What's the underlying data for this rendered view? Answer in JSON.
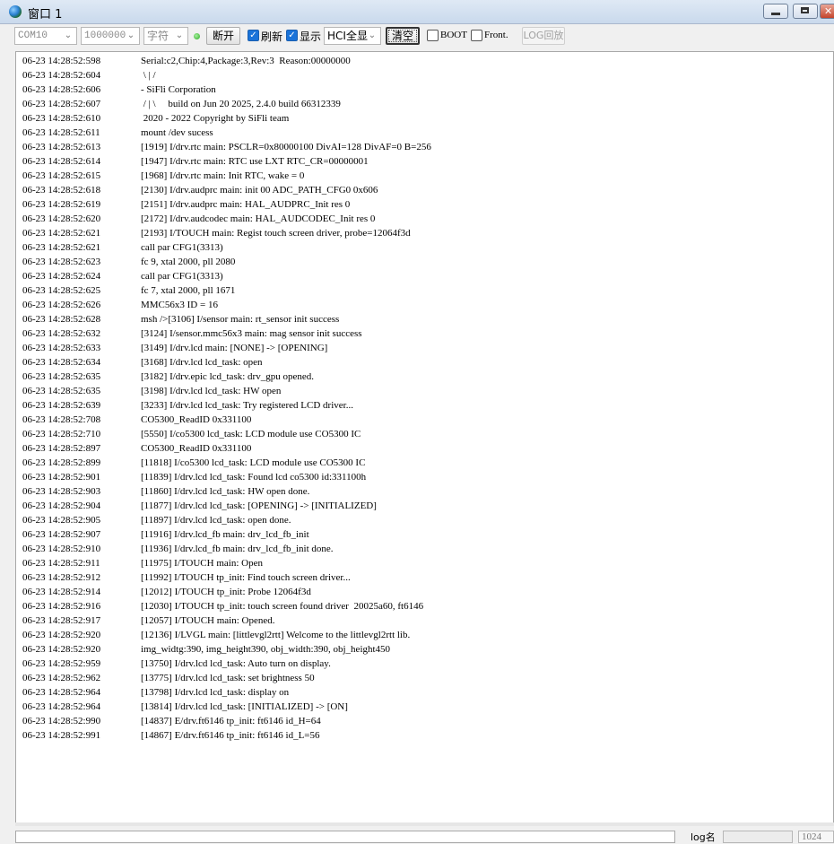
{
  "window": {
    "title": "窗口 1",
    "icon": "globe-icon",
    "minimize_icon": "minimize-icon",
    "maximize_icon": "maximize-icon",
    "close_icon": "close-icon",
    "close_glyph": "✕"
  },
  "toolbar": {
    "port": "COM10",
    "baud": "1000000",
    "format": "字符",
    "connection_status_color": "#27a81f",
    "disconnect_label": "断开",
    "refresh_label": "刷新",
    "refresh_checked": true,
    "display_label": "显示",
    "display_checked": true,
    "hci_mode": "HCI全显",
    "clear_label": "清空",
    "boot_label": "BOOT",
    "boot_checked": false,
    "front_label": "Front.",
    "front_checked": false,
    "log_replay_label": "LOG回放",
    "dropdown_glyph": "⌄"
  },
  "log_lines": [
    {
      "ts": "06-23 14:28:52:598",
      "msg": "Serial:c2,Chip:4,Package:3,Rev:3  Reason:00000000"
    },
    {
      "ts": "06-23 14:28:52:604",
      "msg": " \\ | /"
    },
    {
      "ts": "06-23 14:28:52:606",
      "msg": "- SiFli Corporation"
    },
    {
      "ts": "06-23 14:28:52:607",
      "msg": " / | \\     build on Jun 20 2025, 2.4.0 build 66312339"
    },
    {
      "ts": "06-23 14:28:52:610",
      "msg": " 2020 - 2022 Copyright by SiFli team"
    },
    {
      "ts": "06-23 14:28:52:611",
      "msg": "mount /dev sucess"
    },
    {
      "ts": "06-23 14:28:52:613",
      "msg": "[1919] I/drv.rtc main: PSCLR=0x80000100 DivAI=128 DivAF=0 B=256"
    },
    {
      "ts": "06-23 14:28:52:614",
      "msg": "[1947] I/drv.rtc main: RTC use LXT RTC_CR=00000001"
    },
    {
      "ts": "06-23 14:28:52:615",
      "msg": "[1968] I/drv.rtc main: Init RTC, wake = 0"
    },
    {
      "ts": "06-23 14:28:52:618",
      "msg": "[2130] I/drv.audprc main: init 00 ADC_PATH_CFG0 0x606"
    },
    {
      "ts": "06-23 14:28:52:619",
      "msg": "[2151] I/drv.audprc main: HAL_AUDPRC_Init res 0"
    },
    {
      "ts": "06-23 14:28:52:620",
      "msg": "[2172] I/drv.audcodec main: HAL_AUDCODEC_Init res 0"
    },
    {
      "ts": "06-23 14:28:52:621",
      "msg": "[2193] I/TOUCH main: Regist touch screen driver, probe=12064f3d"
    },
    {
      "ts": "06-23 14:28:52:621",
      "msg": "call par CFG1(3313)"
    },
    {
      "ts": "06-23 14:28:52:623",
      "msg": "fc 9, xtal 2000, pll 2080"
    },
    {
      "ts": "06-23 14:28:52:624",
      "msg": "call par CFG1(3313)"
    },
    {
      "ts": "06-23 14:28:52:625",
      "msg": "fc 7, xtal 2000, pll 1671"
    },
    {
      "ts": "06-23 14:28:52:626",
      "msg": "MMC56x3 ID = 16"
    },
    {
      "ts": "06-23 14:28:52:628",
      "msg": "msh />[3106] I/sensor main: rt_sensor init success"
    },
    {
      "ts": "06-23 14:28:52:632",
      "msg": "[3124] I/sensor.mmc56x3 main: mag sensor init success"
    },
    {
      "ts": "06-23 14:28:52:633",
      "msg": "[3149] I/drv.lcd main: [NONE] -> [OPENING]"
    },
    {
      "ts": "06-23 14:28:52:634",
      "msg": "[3168] I/drv.lcd lcd_task: open"
    },
    {
      "ts": "06-23 14:28:52:635",
      "msg": "[3182] I/drv.epic lcd_task: drv_gpu opened."
    },
    {
      "ts": "06-23 14:28:52:635",
      "msg": "[3198] I/drv.lcd lcd_task: HW open"
    },
    {
      "ts": "06-23 14:28:52:639",
      "msg": "[3233] I/drv.lcd lcd_task: Try registered LCD driver..."
    },
    {
      "ts": "06-23 14:28:52:708",
      "msg": "CO5300_ReadID 0x331100"
    },
    {
      "ts": "06-23 14:28:52:710",
      "msg": "[5550] I/co5300 lcd_task: LCD module use CO5300 IC"
    },
    {
      "ts": "06-23 14:28:52:897",
      "msg": "CO5300_ReadID 0x331100"
    },
    {
      "ts": "06-23 14:28:52:899",
      "msg": "[11818] I/co5300 lcd_task: LCD module use CO5300 IC"
    },
    {
      "ts": "06-23 14:28:52:901",
      "msg": "[11839] I/drv.lcd lcd_task: Found lcd co5300 id:331100h"
    },
    {
      "ts": "06-23 14:28:52:903",
      "msg": "[11860] I/drv.lcd lcd_task: HW open done."
    },
    {
      "ts": "06-23 14:28:52:904",
      "msg": "[11877] I/drv.lcd lcd_task: [OPENING] -> [INITIALIZED]"
    },
    {
      "ts": "06-23 14:28:52:905",
      "msg": "[11897] I/drv.lcd lcd_task: open done."
    },
    {
      "ts": "06-23 14:28:52:907",
      "msg": "[11916] I/drv.lcd_fb main: drv_lcd_fb_init"
    },
    {
      "ts": "06-23 14:28:52:910",
      "msg": "[11936] I/drv.lcd_fb main: drv_lcd_fb_init done."
    },
    {
      "ts": "06-23 14:28:52:911",
      "msg": "[11975] I/TOUCH main: Open"
    },
    {
      "ts": "06-23 14:28:52:912",
      "msg": "[11992] I/TOUCH tp_init: Find touch screen driver..."
    },
    {
      "ts": "06-23 14:28:52:914",
      "msg": "[12012] I/TOUCH tp_init: Probe 12064f3d"
    },
    {
      "ts": "06-23 14:28:52:916",
      "msg": "[12030] I/TOUCH tp_init: touch screen found driver  20025a60, ft6146"
    },
    {
      "ts": "06-23 14:28:52:917",
      "msg": "[12057] I/TOUCH main: Opened."
    },
    {
      "ts": "06-23 14:28:52:920",
      "msg": "[12136] I/LVGL main: [littlevgl2rtt] Welcome to the littlevgl2rtt lib."
    },
    {
      "ts": "06-23 14:28:52:920",
      "msg": "img_widtg:390, img_height390, obj_width:390, obj_height450"
    },
    {
      "ts": "06-23 14:28:52:959",
      "msg": "[13750] I/drv.lcd lcd_task: Auto turn on display."
    },
    {
      "ts": "06-23 14:28:52:962",
      "msg": "[13775] I/drv.lcd lcd_task: set brightness 50"
    },
    {
      "ts": "06-23 14:28:52:964",
      "msg": "[13798] I/drv.lcd lcd_task: display on"
    },
    {
      "ts": "06-23 14:28:52:964",
      "msg": "[13814] I/drv.lcd lcd_task: [INITIALIZED] -> [ON]"
    },
    {
      "ts": "06-23 14:28:52:990",
      "msg": "[14837] E/drv.ft6146 tp_init: ft6146 id_H=64"
    },
    {
      "ts": "06-23 14:28:52:991",
      "msg": "[14867] E/drv.ft6146 tp_init: ft6146 id_L=56"
    }
  ],
  "bottom": {
    "send_value": "",
    "log_name_label": "log名",
    "log_name_value": "",
    "size_value": "1024"
  }
}
